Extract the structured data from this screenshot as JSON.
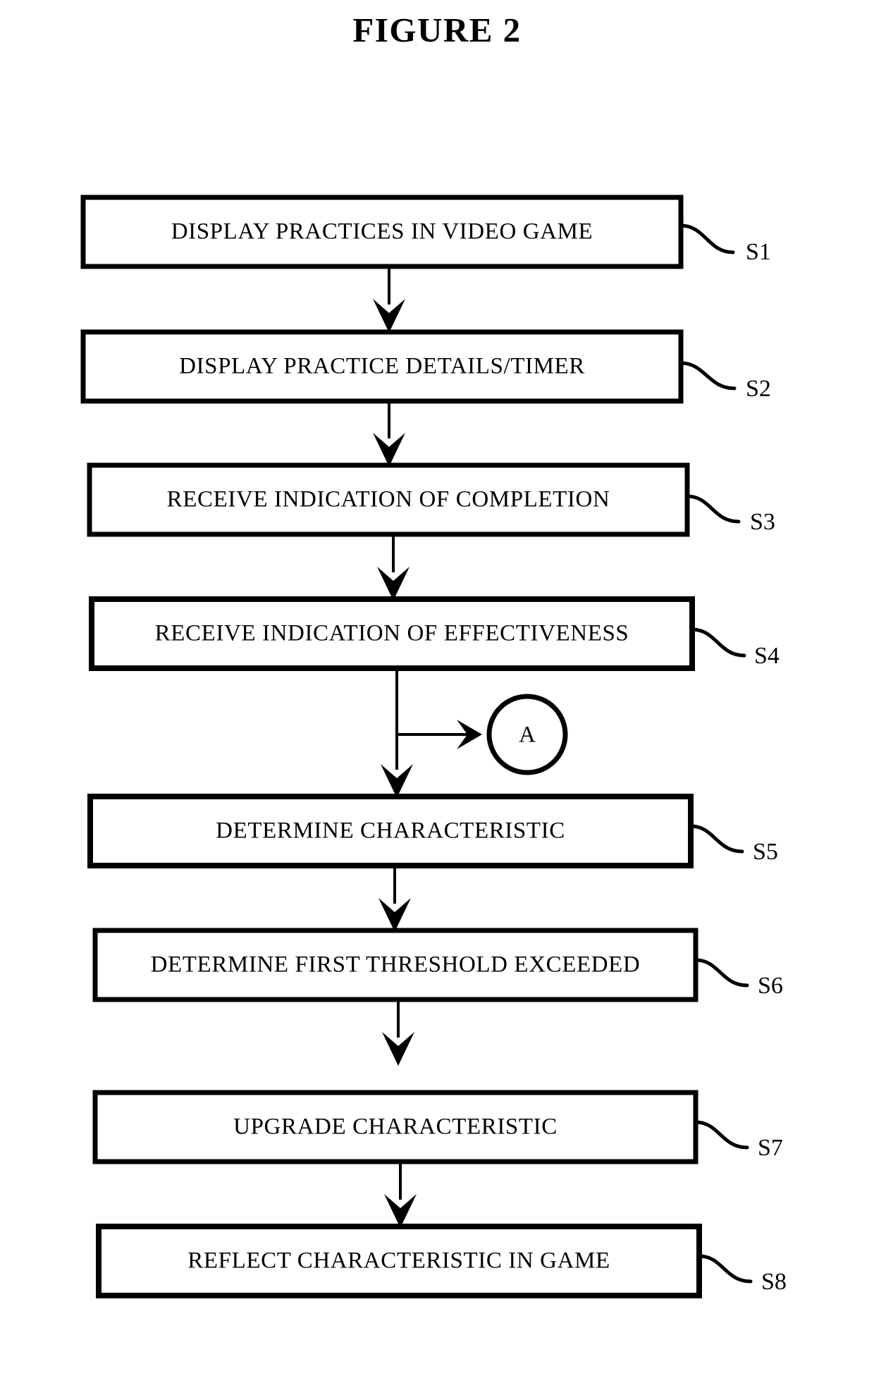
{
  "figure": {
    "title": "FIGURE 2"
  },
  "flowchart": {
    "type": "flowchart",
    "orientation": "vertical",
    "steps": [
      {
        "ref": "S1",
        "label": "DISPLAY PRACTICES IN VIDEO GAME"
      },
      {
        "ref": "S2",
        "label": "DISPLAY PRACTICE DETAILS/TIMER"
      },
      {
        "ref": "S3",
        "label": "RECEIVE INDICATION OF COMPLETION"
      },
      {
        "ref": "S4",
        "label": "RECEIVE INDICATION OF EFFECTIVENESS"
      },
      {
        "ref": "S5",
        "label": "DETERMINE CHARACTERISTIC"
      },
      {
        "ref": "S6",
        "label": "DETERMINE FIRST THRESHOLD EXCEEDED"
      },
      {
        "ref": "S7",
        "label": "UPGRADE CHARACTERISTIC"
      },
      {
        "ref": "S8",
        "label": "REFLECT CHARACTERISTIC IN GAME"
      }
    ],
    "offpage_connectors": [
      {
        "label": "A",
        "from_ref": "S4"
      }
    ],
    "colors": {
      "stroke": "#000000",
      "fill": "#ffffff",
      "text": "#000000"
    }
  }
}
